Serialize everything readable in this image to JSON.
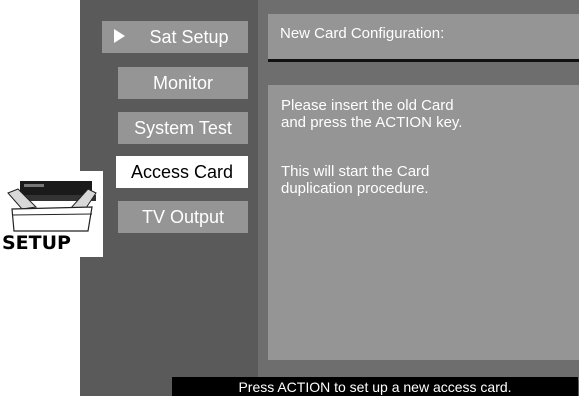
{
  "menu": {
    "items": [
      {
        "label": "Sat Setup"
      },
      {
        "label": "Monitor"
      },
      {
        "label": "System Test"
      },
      {
        "label": "Access Card"
      },
      {
        "label": "TV Output"
      }
    ]
  },
  "panel": {
    "title": "New Card Configuration:",
    "message_line1": "Please insert the old Card",
    "message_line2": "and press the ACTION key.",
    "message_line3": "This will start the Card",
    "message_line4": "duplication procedure."
  },
  "status": {
    "text": "Press ACTION to set up a new access card."
  },
  "logo": {
    "text": "SETUP"
  },
  "colors": {
    "background": "#5a5a5a",
    "menu_item": "#959595",
    "menu_item_active": "#ffffff",
    "status_bar": "#000000"
  },
  "icons": {
    "selected_marker": "triangle-right-icon",
    "setup_logo": "open-box-receiver-icon"
  }
}
